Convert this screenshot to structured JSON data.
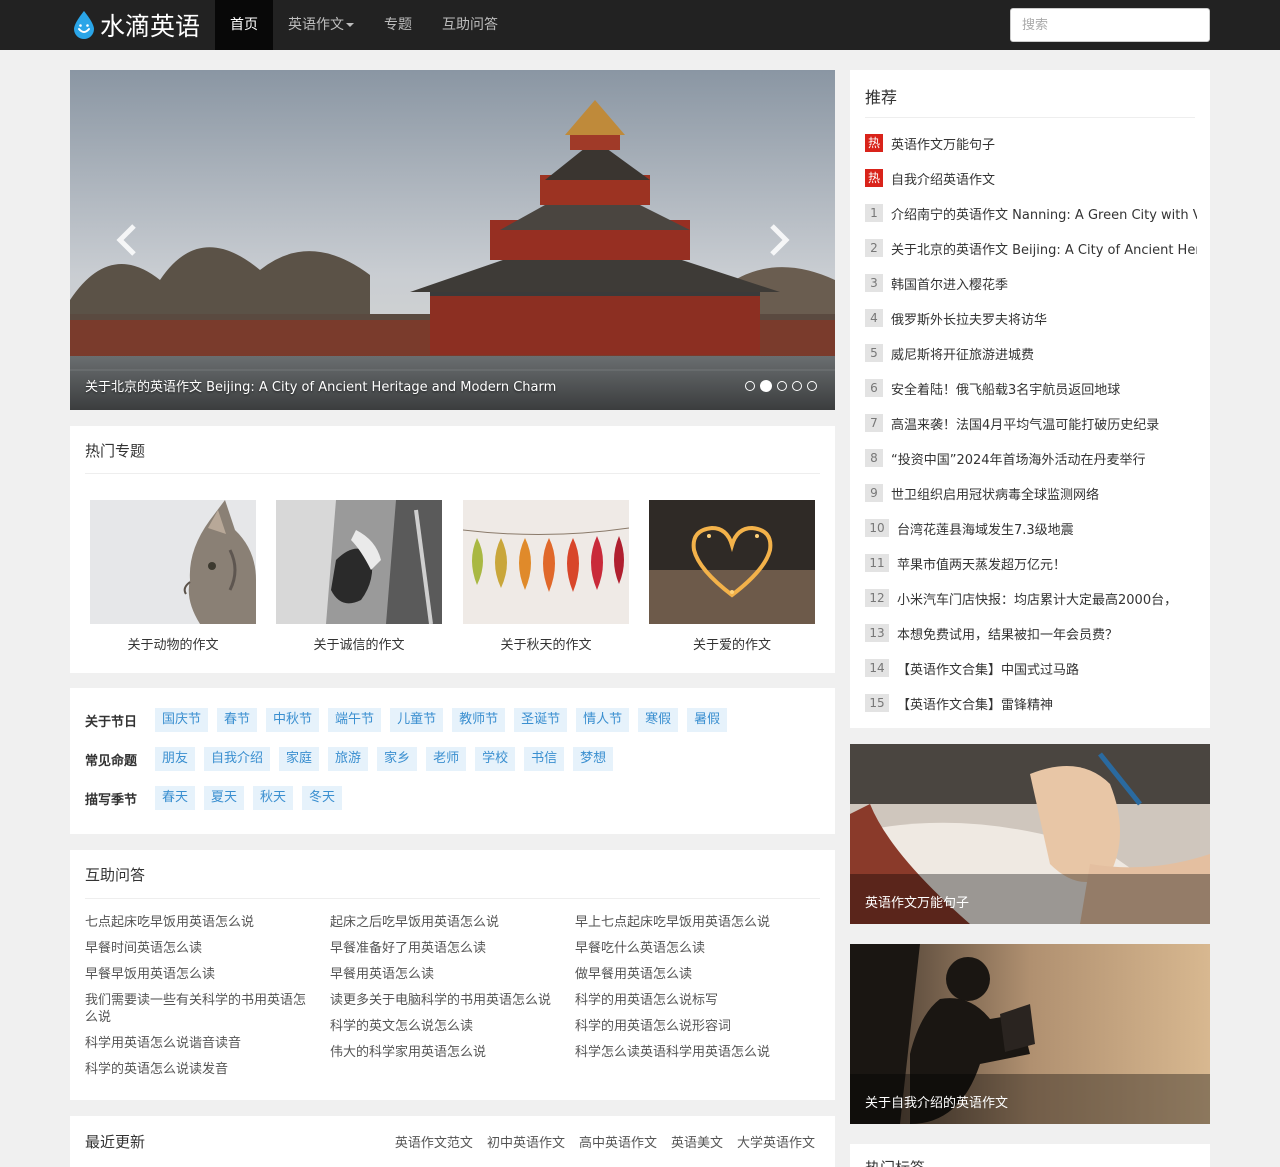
{
  "brand": {
    "name": "水滴英语"
  },
  "nav": [
    {
      "label": "首页"
    },
    {
      "label": "英语作文"
    },
    {
      "label": "专题"
    },
    {
      "label": "互助问答"
    }
  ],
  "search": {
    "placeholder": "搜索"
  },
  "carousel": {
    "caption": "关于北京的英语作文 Beijing: A City of Ancient Heritage and Modern Charm",
    "slide_count": 5,
    "active_index": 1
  },
  "hot_topics": {
    "title": "热门专题",
    "items": [
      {
        "label": "关于动物的作文"
      },
      {
        "label": "关于诚信的作文"
      },
      {
        "label": "关于秋天的作文"
      },
      {
        "label": "关于爱的作文"
      }
    ]
  },
  "tags": {
    "rows": [
      {
        "head": "关于节日",
        "tags": [
          "国庆节",
          "春节",
          "中秋节",
          "端午节",
          "儿童节",
          "教师节",
          "圣诞节",
          "情人节",
          "寒假",
          "暑假"
        ]
      },
      {
        "head": "常见命题",
        "tags": [
          "朋友",
          "自我介绍",
          "家庭",
          "旅游",
          "家乡",
          "老师",
          "学校",
          "书信",
          "梦想"
        ]
      },
      {
        "head": "描写季节",
        "tags": [
          "春天",
          "夏天",
          "秋天",
          "冬天"
        ]
      }
    ]
  },
  "qa": {
    "title": "互助问答",
    "columns": [
      [
        "七点起床吃早饭用英语怎么说",
        "早餐时间英语怎么读",
        "早餐早饭用英语怎么读",
        "我们需要读一些有关科学的书用英语怎么说",
        "科学用英语怎么说谐音读音",
        "科学的英语怎么说读发音"
      ],
      [
        "起床之后吃早饭用英语怎么说",
        "早餐准备好了用英语怎么读",
        "早餐用英语怎么读",
        "读更多关于电脑科学的书用英语怎么说",
        "科学的英文怎么说怎么读",
        "伟大的科学家用英语怎么说"
      ],
      [
        "早上七点起床吃早饭用英语怎么说",
        "早餐吃什么英语怎么读",
        "做早餐用英语怎么读",
        "科学的用英语怎么说标写",
        "科学的用英语怎么说形容词",
        "科学怎么读英语科学用英语怎么说"
      ]
    ]
  },
  "recent": {
    "title": "最近更新",
    "links": [
      "英语作文范文",
      "初中英语作文",
      "高中英语作文",
      "英语美文",
      "大学英语作文"
    ]
  },
  "recommend": {
    "title": "推荐",
    "items": [
      {
        "badge": "热",
        "text": "英语作文万能句子"
      },
      {
        "badge": "热",
        "text": "自我介绍英语作文"
      },
      {
        "badge": "1",
        "text": "介绍南宁的英语作文 Nanning: A Green City with Vibrant Culture"
      },
      {
        "badge": "2",
        "text": "关于北京的英语作文 Beijing: A City of Ancient Heritage"
      },
      {
        "badge": "3",
        "text": "韩国首尔进入樱花季"
      },
      {
        "badge": "4",
        "text": "俄罗斯外长拉夫罗夫将访华"
      },
      {
        "badge": "5",
        "text": "威尼斯将开征旅游进城费"
      },
      {
        "badge": "6",
        "text": "安全着陆！俄飞船载3名宇航员返回地球"
      },
      {
        "badge": "7",
        "text": "高温来袭！法国4月平均气温可能打破历史纪录"
      },
      {
        "badge": "8",
        "text": "“投资中国”2024年首场海外活动在丹麦举行"
      },
      {
        "badge": "9",
        "text": "世卫组织启用冠状病毒全球监测网络"
      },
      {
        "badge": "10",
        "text": "台湾花莲县海域发生7.3级地震"
      },
      {
        "badge": "11",
        "text": "苹果市值两天蒸发超万亿元！"
      },
      {
        "badge": "12",
        "text": "小米汽车门店快报：均店累计大定最高2000台，"
      },
      {
        "badge": "13",
        "text": "本想免费试用，结果被扣一年会员费？"
      },
      {
        "badge": "14",
        "text": "【英语作文合集】中国式过马路"
      },
      {
        "badge": "15",
        "text": "【英语作文合集】雷锋精神"
      }
    ]
  },
  "side_features": [
    {
      "caption": "英语作文万能句子"
    },
    {
      "caption": "关于自我介绍的英语作文"
    }
  ],
  "hot_tags": {
    "title": "热门标签"
  },
  "colors": {
    "navbar": "#222222",
    "hot_badge": "#d9231a",
    "tag_bg": "#e6f2fb",
    "tag_text": "#3a8fd0"
  }
}
